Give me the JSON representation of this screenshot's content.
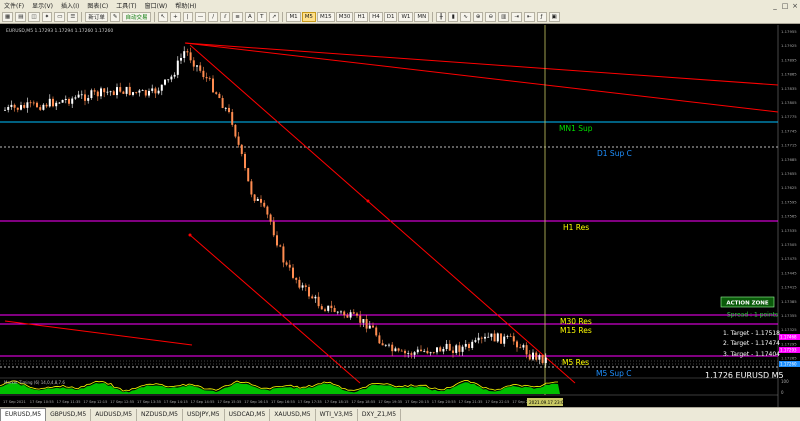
{
  "menu": [
    "文件(F)",
    "显示(V)",
    "插入(I)",
    "图表(C)",
    "工具(T)",
    "窗口(W)",
    "帮助(H)"
  ],
  "window_controls": [
    "_",
    "□",
    "×"
  ],
  "toolbar": {
    "new_order": "新订单",
    "auto_trading": "自动交易",
    "periods": [
      "M1",
      "M5",
      "M15",
      "M30",
      "H1",
      "H4",
      "D1",
      "W1",
      "MN"
    ],
    "active_period": "M5"
  },
  "chart": {
    "header": "EURUSD,M5  1.17293 1.17294 1.17260 1.17260",
    "price_labels": [
      "1.17955",
      "1.17925",
      "1.17895",
      "1.17865",
      "1.17835",
      "1.17805",
      "1.17775",
      "1.17745",
      "1.17715",
      "1.17685",
      "1.17655",
      "1.17625",
      "1.17595",
      "1.17565",
      "1.17535",
      "1.17505",
      "1.17475",
      "1.17445",
      "1.17415",
      "1.17385",
      "1.17355",
      "1.17325",
      "1.17295",
      "1.17265"
    ],
    "levels": [
      {
        "name": "MN1 Sup",
        "value": "1.17718",
        "color": "#00bfff",
        "style": "solid",
        "text_color": "#00e000"
      },
      {
        "name": "D1 Sup C",
        "value": "1.17666",
        "color": "#bbbbbb",
        "style": "dash",
        "text_color": "#1e90ff"
      },
      {
        "name": "H1 Res",
        "value": "1.17468",
        "color": "#ff00ff",
        "style": "solid",
        "text_color": "#ffff00"
      },
      {
        "name": "M30 Res",
        "value": "1.17349",
        "color": "#ff00ff",
        "style": "solid",
        "text_color": "#ffff00"
      },
      {
        "name": "M15 Res",
        "value": "1.17334",
        "color": "#ff00ff",
        "style": "solid",
        "text_color": "#ffff00"
      },
      {
        "name": "M5 Res",
        "value": "1.17293",
        "color": "#ff00ff",
        "style": "solid",
        "text_color": "#ffff00"
      },
      {
        "name": "M5 Sup C",
        "value": "1.17268",
        "color": "#bbbbbb",
        "style": "dash",
        "text_color": "#1e90ff"
      }
    ],
    "action_zone": "ACTION ZONE",
    "spread": "Spread : 1 points",
    "targets": [
      "1. Target - 1.17518",
      "2. Target - 1.17474",
      "3. Target - 1.17404"
    ],
    "symbol_price": "1.1726 EURUSD M5",
    "current_price": "1.17260",
    "price_tag_top": "1.17293",
    "indicator_title": "Market Timing (6) 14,0,4,8,7.6",
    "indicator_scale": [
      "100",
      "0"
    ],
    "time_labels": [
      "17 Sep 2021",
      "17 Sep 10:55",
      "17 Sep 11:35",
      "17 Sep 12:15",
      "17 Sep 12:55",
      "17 Sep 13:35",
      "17 Sep 14:15",
      "17 Sep 14:55",
      "17 Sep 15:35",
      "17 Sep 16:15",
      "17 Sep 16:55",
      "17 Sep 17:35",
      "17 Sep 18:15",
      "17 Sep 18:55",
      "17 Sep 19:35",
      "17 Sep 20:15",
      "17 Sep 20:55",
      "17 Sep 21:35",
      "17 Sep 22:15",
      "17 Sep 22:55"
    ],
    "time_cursor": "2021.09.17 23:00"
  },
  "tabs": [
    "EURUSD,M5",
    "GBPUSD,M5",
    "AUDUSD,M5",
    "NZDUSD,M5",
    "USDJPY,M5",
    "USDCAD,M5",
    "XAUUSD,M5",
    "WTI_V3,M5",
    "DXY_Z1,M5"
  ],
  "active_tab": "EURUSD,M5",
  "colors": {
    "background": "#000000",
    "bull": "#ffffff",
    "bear": "#ff8c50",
    "channel": "#ff0000",
    "cursor": "#c8c864",
    "indicator_line": "#ffff00",
    "indicator_area": "#00c000"
  }
}
